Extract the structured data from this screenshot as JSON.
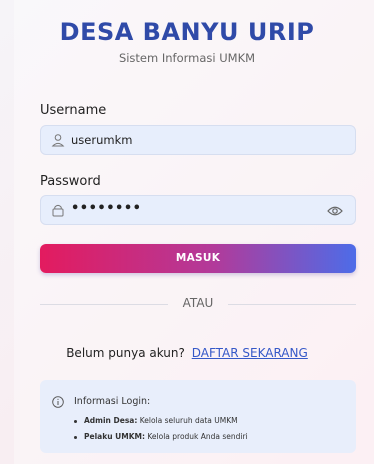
{
  "header": {
    "title": "DESA BANYU URIP",
    "subtitle": "Sistem Informasi UMKM"
  },
  "form": {
    "username_label": "Username",
    "username_value": "userumkm",
    "password_label": "Password",
    "password_value": "••••••••",
    "submit_label": "MASUK"
  },
  "divider": {
    "text": "ATAU"
  },
  "signup": {
    "prompt": "Belum punya akun?",
    "link_label": "DAFTAR SEKARANG"
  },
  "info": {
    "title": "Informasi Login:",
    "items": [
      {
        "role": "Admin Desa:",
        "desc": "Kelola seluruh data UMKM"
      },
      {
        "role": "Pelaku UMKM:",
        "desc": "Kelola produk Anda sendiri"
      }
    ]
  },
  "colors": {
    "title": "#2f4aa8",
    "field_bg": "#e7eefc",
    "button_start": "#e31b5f",
    "button_end": "#4d6ce8",
    "link": "#3558c8"
  },
  "icons": {
    "username": "user-icon",
    "password": "lock-icon",
    "toggle": "eye-icon",
    "info": "info-icon"
  }
}
